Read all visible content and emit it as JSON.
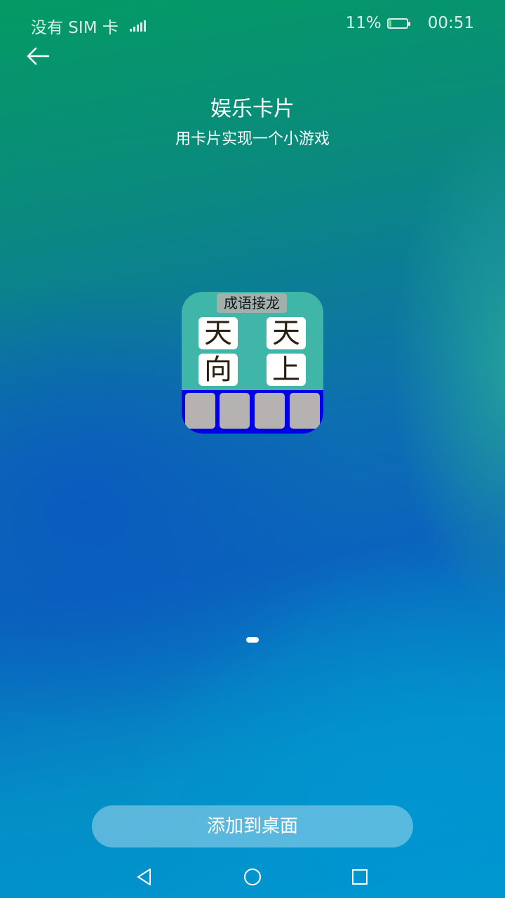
{
  "status_bar": {
    "carrier": "没有 SIM 卡",
    "battery_percent": "11%",
    "time": "00:51",
    "battery_level": 0.11
  },
  "header": {
    "back_icon": "arrow-left-icon",
    "title": "娱乐卡片",
    "subtitle": "用卡片实现一个小游戏"
  },
  "card": {
    "title": "成语接龙",
    "tiles": [
      "天",
      "天",
      "向",
      "上"
    ],
    "slot_count": 4,
    "colors": {
      "body": "#3fb6a8",
      "slots_bg": "#0000e6",
      "slot": "#b7b2b2"
    }
  },
  "pager": {
    "pages": 1,
    "current": 1
  },
  "add_button": {
    "label": "添加到桌面"
  },
  "nav": {
    "back_icon": "triangle-back-icon",
    "home_icon": "circle-home-icon",
    "recent_icon": "square-recent-icon"
  }
}
